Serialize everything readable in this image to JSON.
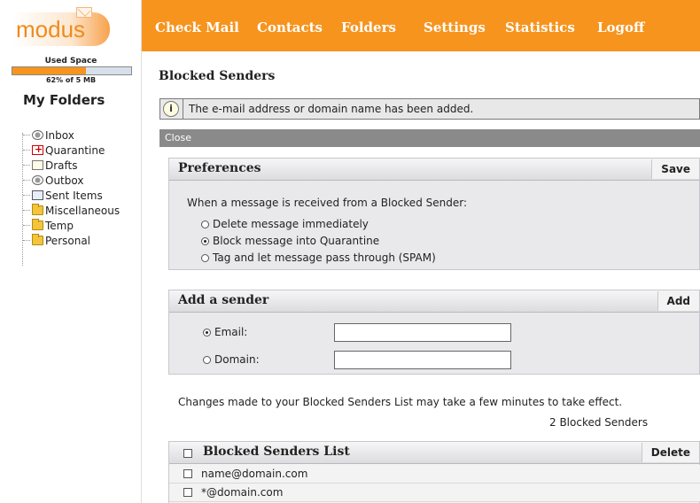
{
  "app": {
    "logo_text": "modus",
    "nav": [
      "Check Mail",
      "Contacts",
      "Folders",
      "Settings",
      "Statistics",
      "Logoff"
    ]
  },
  "sidebar": {
    "usage_label": "Used Space",
    "usage_text": "62% of 5 MB",
    "usage_fraction": 0.62,
    "title": "My Folders",
    "folders": [
      "Inbox",
      "Quarantine",
      "Drafts",
      "Outbox",
      "Sent Items",
      "Miscellaneous",
      "Temp",
      "Personal"
    ]
  },
  "main": {
    "title": "Blocked Senders",
    "notice": "The e-mail address or domain name has been added.",
    "notice_icon": "info-icon",
    "close_label": "Close",
    "preferences": {
      "title": "Preferences",
      "save_label": "Save",
      "question": "When a message is received from a Blocked Sender:",
      "options": [
        "Delete message immediately",
        "Block message into Quarantine",
        "Tag and let message pass through (SPAM)"
      ],
      "selected_index": 1
    },
    "add_sender": {
      "title": "Add a sender",
      "add_label": "Add",
      "email_label": "Email:",
      "domain_label": "Domain:",
      "email_value": "",
      "domain_value": "",
      "selected": "Email"
    },
    "note": "Changes made to your Blocked Senders List may take a few minutes to take effect.",
    "count_text": "2 Blocked Senders",
    "list": {
      "title": "Blocked Senders List",
      "delete_label": "Delete",
      "items": [
        "name@domain.com",
        "*@domain.com"
      ]
    }
  }
}
